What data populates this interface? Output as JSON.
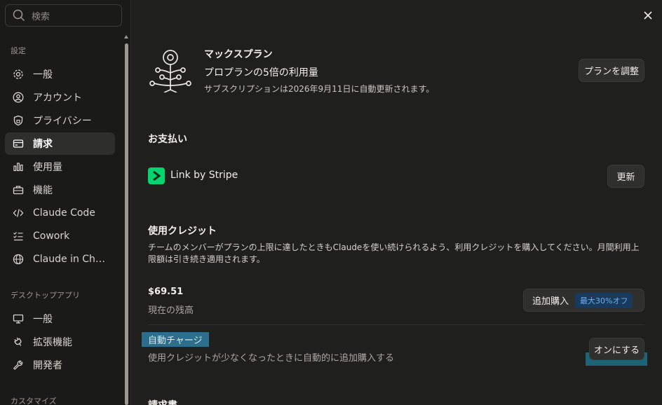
{
  "sidebar": {
    "search_placeholder": "検索",
    "section_settings": "設定",
    "settings_items": [
      {
        "label": "一般",
        "icon": "gear-icon"
      },
      {
        "label": "アカウント",
        "icon": "user-circle-icon"
      },
      {
        "label": "プライバシー",
        "icon": "shield-icon"
      },
      {
        "label": "請求",
        "icon": "credit-card-icon",
        "active": true
      },
      {
        "label": "使用量",
        "icon": "bar-chart-icon"
      },
      {
        "label": "機能",
        "icon": "toolbox-icon"
      },
      {
        "label": "Claude Code",
        "icon": "code-icon"
      },
      {
        "label": "Cowork",
        "icon": "checklist-icon"
      },
      {
        "label": "Claude in Chr…",
        "icon": "globe-icon"
      }
    ],
    "section_desktop": "デスクトップアプリ",
    "desktop_items": [
      {
        "label": "一般",
        "icon": "monitor-icon"
      },
      {
        "label": "拡張機能",
        "icon": "plug-icon"
      },
      {
        "label": "開発者",
        "icon": "wrench-icon"
      }
    ],
    "section_customize": "カスタマイズ"
  },
  "plan": {
    "name": "マックスプラン",
    "description": "プロプランの5倍の利用量",
    "renewal": "サブスクリプションは2026年9月11日に自動更新されます。",
    "adjust_button": "プランを調整"
  },
  "payment": {
    "title": "お支払い",
    "method": "Link by Stripe",
    "update_button": "更新"
  },
  "credits": {
    "title": "使用クレジット",
    "description": "チームのメンバーがプランの上限に達したときもClaudeを使い続けられるよう、利用クレジットを購入してください。月間利用上限額は引き続き適用されます。",
    "balance": "$69.51",
    "balance_label": "現在の残高",
    "buy_button": "追加購入",
    "discount_badge": "最大30%オフ",
    "autocharge_title": "自動チャージ",
    "autocharge_description": "使用クレジットが少なくなったときに自動的に追加購入する",
    "autocharge_button": "オンにする"
  },
  "next_section_title": "請求書",
  "colors": {
    "background": "#1f1f1e",
    "sidebar": "#1a1a19",
    "stripe_green": "#00d66f",
    "badge_bg": "#183a5c",
    "badge_text": "#6fb0f0",
    "highlight": "#2b6f8c"
  }
}
